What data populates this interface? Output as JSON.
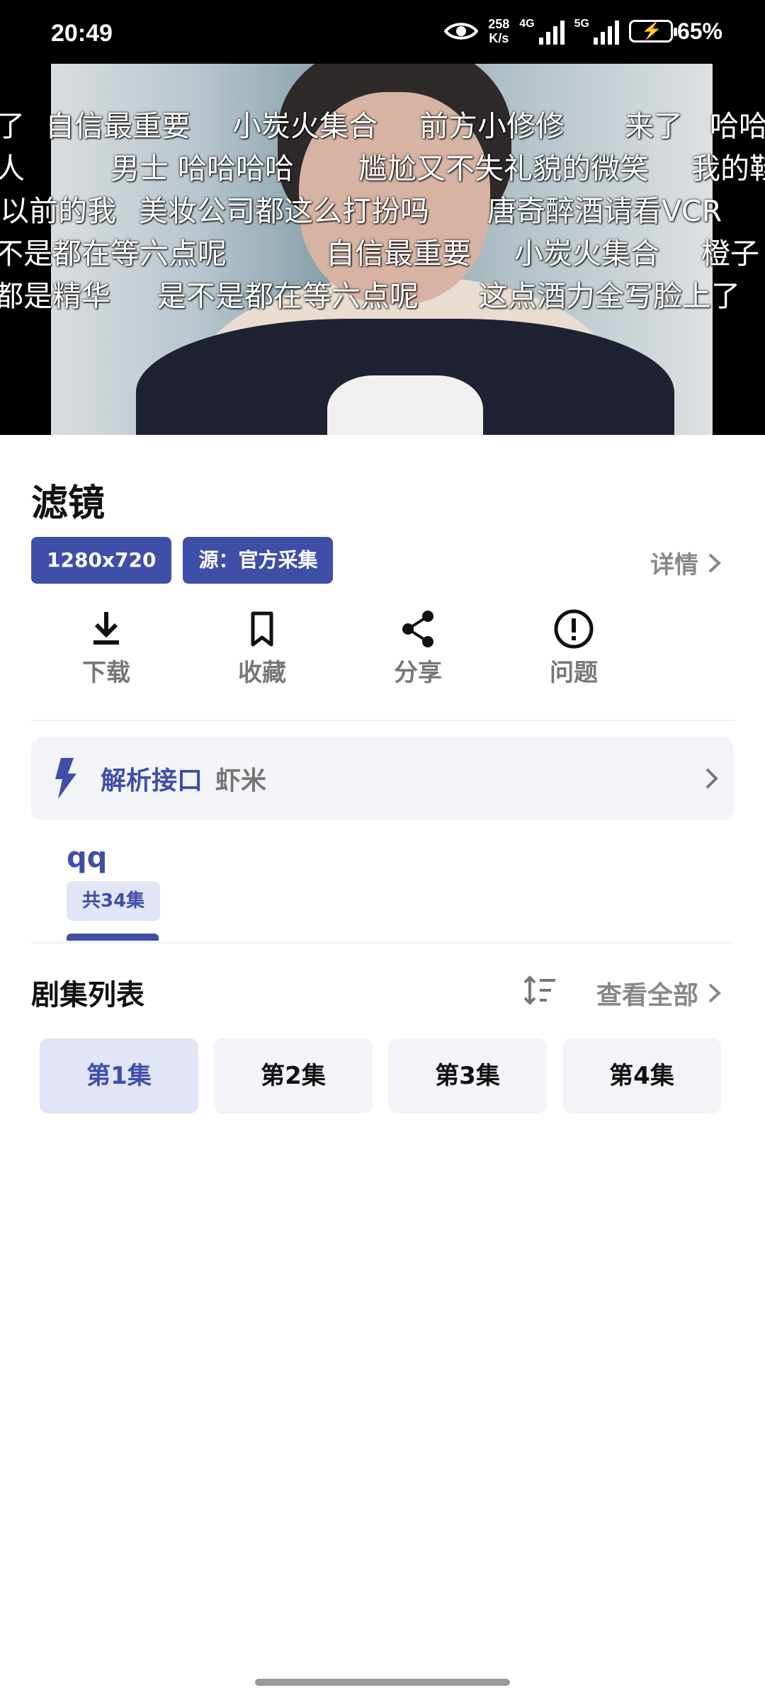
{
  "status_bar": {
    "time": "20:49",
    "net_speed_value": "258",
    "net_speed_unit": "K/s",
    "sig1_label": "4G",
    "sig2_label": "5G",
    "battery": "65%"
  },
  "danmaku": [
    [
      "了",
      "自信最重要",
      "小炭火集合",
      "前方小修修",
      "来了",
      "哈哈"
    ],
    [
      "人",
      "男士 哈哈哈哈",
      "尴尬又不失礼貌的微笑",
      "我的鞋"
    ],
    [
      "以前的我",
      "美妆公司都这么打扮吗",
      "唐奇醉酒请看VCR"
    ],
    [
      "不是都在等六点呢",
      "自信最重要",
      "小炭火集合",
      "橙子"
    ],
    [
      "都是精华",
      "是不是都在等六点呢",
      "这点酒力全写脸上了"
    ]
  ],
  "info": {
    "title": "滤镜",
    "resolution": "1280x720",
    "source": "源：官方采集",
    "detail": "详情"
  },
  "actions": {
    "download": "下载",
    "favorite": "收藏",
    "share": "分享",
    "issue": "问题"
  },
  "api": {
    "label": "解析接口",
    "value": "虾米"
  },
  "sources": {
    "name": "qq",
    "count": "共34集"
  },
  "episodes": {
    "heading": "剧集列表",
    "view_all": "查看全部",
    "items": [
      "第1集",
      "第2集",
      "第3集",
      "第4集"
    ],
    "active_index": 0
  },
  "colors": {
    "accent": "#3f4fa8",
    "accent_light": "#e2e5f5",
    "chip_bg": "#f3f4f8"
  }
}
